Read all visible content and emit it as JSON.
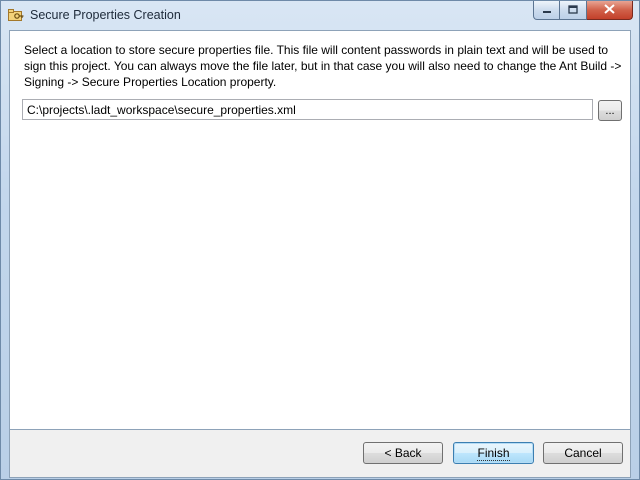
{
  "window": {
    "title": "Secure Properties Creation",
    "icons": {
      "app": "key-folder-icon",
      "minimize": "minimize-icon",
      "maximize": "maximize-icon",
      "close": "close-icon"
    }
  },
  "main": {
    "description": "Select a location to store secure properties file. This file will content passwords in plain text and will be used to sign this project. You can always move the file later, but in that case you will also need to change the Ant Build -> Signing -> Secure Properties Location property.",
    "path_value": "C:\\projects\\.ladt_workspace\\secure_properties.xml",
    "browse_label": "..."
  },
  "footer": {
    "back_label": "< Back",
    "finish_label": "Finish",
    "cancel_label": "Cancel"
  },
  "colors": {
    "titlebar": "#c3d7ec",
    "close_button": "#c3402a",
    "default_button_border": "#3c7fb1"
  }
}
